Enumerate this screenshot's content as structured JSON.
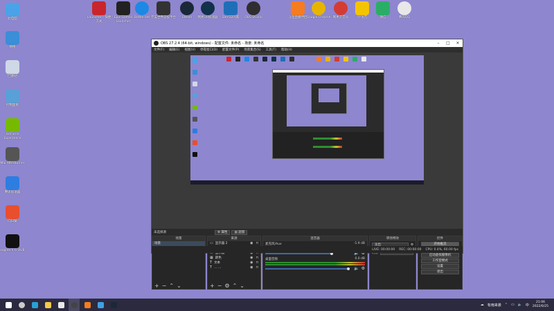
{
  "desktop": {
    "left_icons": [
      {
        "label": "此电脑",
        "color": "#4aa3e8"
      },
      {
        "label": "网络",
        "color": "#3b8ed8"
      },
      {
        "label": "回收站",
        "color": "#cfd8e6"
      },
      {
        "label": "控制面板",
        "color": "#5aa0d8"
      },
      {
        "label": "GeForce Experience",
        "color": "#76b900"
      },
      {
        "label": "MSI Afterburner",
        "color": "#555555"
      },
      {
        "label": "腾讯加速器",
        "color": "#2e7de0"
      },
      {
        "label": "向日葵",
        "color": "#e94e2e"
      },
      {
        "label": "Logitech G HUB",
        "color": "#111111"
      }
    ],
    "top_icons": [
      {
        "label": "Launcher - 快捷方式",
        "color": "#c8262c"
      },
      {
        "label": "Epic Games Launcher",
        "color": "#222222"
      },
      {
        "label": "Battle.net",
        "color": "#1e88e5"
      },
      {
        "label": "完美世界竞技平台",
        "color": "#333333"
      },
      {
        "label": "Steam",
        "color": "#1b2838"
      },
      {
        "label": "网易UU加速器",
        "color": "#12314a"
      },
      {
        "label": "Sam12的家",
        "color": "#1f6fb8"
      },
      {
        "label": "OBS Studio",
        "color": "#302e31"
      },
      {
        "label": "斗鱼直播伴侣",
        "color": "#f57c20"
      },
      {
        "label": "Google Chrome",
        "color": "#e7b500"
      },
      {
        "label": "网易云音乐",
        "color": "#d43c33"
      },
      {
        "label": "YY语音",
        "color": "#f5c400"
      },
      {
        "label": "微信",
        "color": "#2aae67"
      },
      {
        "label": "腾讯QQ",
        "color": "#e8e8e8"
      }
    ]
  },
  "obs": {
    "title": "OBS 27.2.4 (64-bit, windows) - 配置文件: 未命名 - 场景: 未命名",
    "menu": [
      "文件(F)",
      "编辑(E)",
      "视图(V)",
      "停靠窗口(D)",
      "配置文件(P)",
      "场景集合(S)",
      "工具(T)",
      "帮助(H)"
    ],
    "no_source_label": "未选择源",
    "props_button": "属性",
    "filters_button": "滤镜",
    "docks": {
      "scenes": {
        "title": "场景",
        "items": [
          "场景"
        ]
      },
      "sources": {
        "title": "来源",
        "items": [
          "显示器 2",
          "视频采集设备",
          "显示器",
          "颜色",
          "文本",
          "... ..."
        ]
      },
      "mixer": {
        "title": "混音器",
        "tracks": [
          {
            "name": "麦克风/Aux",
            "db": "-1.9 dB",
            "level": 0.8
          },
          {
            "name": "桌面音频",
            "db": "0.0 dB",
            "level": 1.0
          }
        ]
      },
      "transitions": {
        "title": "转场特效",
        "type": "淡出",
        "duration_label": "时长",
        "duration_value": "300 ms"
      },
      "controls": {
        "title": "控件",
        "buttons": [
          "开始推流",
          "开始录制",
          "启动虚拟摄像机",
          "工作室模式",
          "设置",
          "退出"
        ]
      }
    },
    "status": {
      "live": "LIVE: 00:00:00",
      "rec": "REC: 00:00:00",
      "cpu": "CPU: 0.4%, 60.00 fps"
    }
  },
  "taskbar": {
    "tray_text": "有雨来袭",
    "time": "21:06",
    "date": "2022/6/25",
    "pinned": [
      {
        "name": "start",
        "color": "#ffffff"
      },
      {
        "name": "search",
        "color": "#cccccc"
      },
      {
        "name": "edge",
        "color": "#2aa0d6"
      },
      {
        "name": "explorer",
        "color": "#f2c94c"
      },
      {
        "name": "store",
        "color": "#e9e9e9"
      },
      {
        "name": "obs",
        "color": "#444444"
      },
      {
        "name": "douyu",
        "color": "#f57c20"
      },
      {
        "name": "uu",
        "color": "#3ea0e4"
      },
      {
        "name": "steam",
        "color": "#1b2838"
      }
    ]
  }
}
